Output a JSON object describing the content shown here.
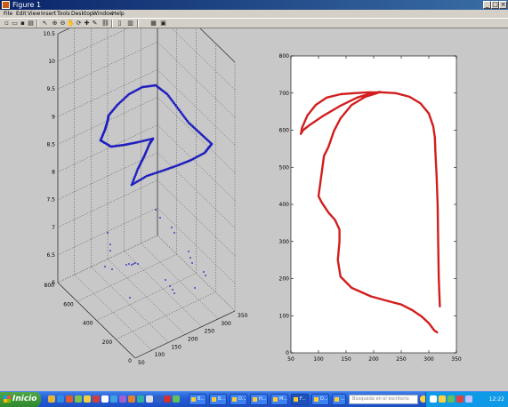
{
  "window": {
    "title": "Figure 1"
  },
  "menu": [
    "File",
    "Edit",
    "View",
    "Insert",
    "Tools",
    "Desktop",
    "Window",
    "Help"
  ],
  "toolbar_icons": [
    "new-icon",
    "open-icon",
    "save-icon",
    "print-icon",
    "select-arrow-icon",
    "zoom-in-icon",
    "zoom-out-icon",
    "pan-icon",
    "rotate-icon",
    "data-cursor-icon",
    "brush-icon",
    "link-icon",
    "colorbar-icon",
    "legend-icon",
    "hide-tools-icon",
    "show-tools-icon"
  ],
  "chart_data": [
    {
      "type": "scatter",
      "projection": "3d",
      "zlim": [
        6,
        10.5
      ],
      "xlim": [
        0,
        800
      ],
      "ylim": [
        50,
        350
      ],
      "x_ticks": [
        "0",
        "200",
        "400",
        "600",
        "800"
      ],
      "y_ticks": [
        "50",
        "100",
        "150",
        "200",
        "250",
        "300",
        "350"
      ],
      "z_ticks": [
        "6",
        "6.5",
        "7",
        "7.5",
        "8",
        "8.5",
        "9",
        "9.5",
        "10",
        "10.5"
      ],
      "grid": true,
      "color": "#1f1fbf"
    },
    {
      "type": "line",
      "color": "#d21e1e",
      "xlim": [
        50,
        350
      ],
      "ylim": [
        0,
        800
      ],
      "x_ticks": [
        "50",
        "100",
        "150",
        "200",
        "250",
        "300",
        "350"
      ],
      "y_ticks": [
        "0",
        "100",
        "200",
        "300",
        "400",
        "500",
        "600",
        "700",
        "800"
      ],
      "x": [
        320,
        318,
        317,
        316,
        314,
        312,
        311,
        308,
        300,
        285,
        265,
        240,
        215,
        190,
        165,
        140,
        115,
        95,
        80,
        70,
        68,
        72,
        85,
        110,
        140,
        170,
        195,
        210,
        212,
        206,
        185,
        160,
        140,
        128,
        118,
        110,
        100,
        106,
        118,
        130,
        138,
        138,
        135,
        140,
        160,
        195,
        225,
        250,
        270,
        287,
        300,
        310,
        315
      ],
      "y": [
        125,
        200,
        300,
        400,
        480,
        540,
        580,
        610,
        645,
        672,
        690,
        700,
        702,
        702,
        700,
        697,
        688,
        668,
        640,
        606,
        590,
        600,
        615,
        640,
        666,
        688,
        699,
        703,
        703,
        700,
        690,
        668,
        632,
        598,
        555,
        531,
        422,
        405,
        378,
        358,
        332,
        300,
        250,
        205,
        175,
        152,
        140,
        130,
        115,
        98,
        80,
        60,
        55
      ]
    }
  ],
  "taskbar": {
    "start_label": "Inicio",
    "tasks": [
      "B...",
      "B...",
      "D...",
      "H...",
      "M...",
      "F...",
      "D...",
      "..."
    ],
    "search_placeholder": "Búsqueda en el escritorio",
    "clock": "12:22"
  }
}
